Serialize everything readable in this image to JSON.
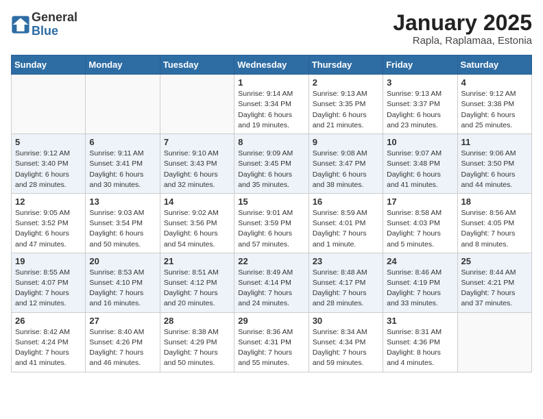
{
  "header": {
    "logo_general": "General",
    "logo_blue": "Blue",
    "month_title": "January 2025",
    "location": "Rapla, Raplamaa, Estonia"
  },
  "weekdays": [
    "Sunday",
    "Monday",
    "Tuesday",
    "Wednesday",
    "Thursday",
    "Friday",
    "Saturday"
  ],
  "weeks": [
    [
      {
        "day": "",
        "info": ""
      },
      {
        "day": "",
        "info": ""
      },
      {
        "day": "",
        "info": ""
      },
      {
        "day": "1",
        "info": "Sunrise: 9:14 AM\nSunset: 3:34 PM\nDaylight: 6 hours\nand 19 minutes."
      },
      {
        "day": "2",
        "info": "Sunrise: 9:13 AM\nSunset: 3:35 PM\nDaylight: 6 hours\nand 21 minutes."
      },
      {
        "day": "3",
        "info": "Sunrise: 9:13 AM\nSunset: 3:37 PM\nDaylight: 6 hours\nand 23 minutes."
      },
      {
        "day": "4",
        "info": "Sunrise: 9:12 AM\nSunset: 3:38 PM\nDaylight: 6 hours\nand 25 minutes."
      }
    ],
    [
      {
        "day": "5",
        "info": "Sunrise: 9:12 AM\nSunset: 3:40 PM\nDaylight: 6 hours\nand 28 minutes."
      },
      {
        "day": "6",
        "info": "Sunrise: 9:11 AM\nSunset: 3:41 PM\nDaylight: 6 hours\nand 30 minutes."
      },
      {
        "day": "7",
        "info": "Sunrise: 9:10 AM\nSunset: 3:43 PM\nDaylight: 6 hours\nand 32 minutes."
      },
      {
        "day": "8",
        "info": "Sunrise: 9:09 AM\nSunset: 3:45 PM\nDaylight: 6 hours\nand 35 minutes."
      },
      {
        "day": "9",
        "info": "Sunrise: 9:08 AM\nSunset: 3:47 PM\nDaylight: 6 hours\nand 38 minutes."
      },
      {
        "day": "10",
        "info": "Sunrise: 9:07 AM\nSunset: 3:48 PM\nDaylight: 6 hours\nand 41 minutes."
      },
      {
        "day": "11",
        "info": "Sunrise: 9:06 AM\nSunset: 3:50 PM\nDaylight: 6 hours\nand 44 minutes."
      }
    ],
    [
      {
        "day": "12",
        "info": "Sunrise: 9:05 AM\nSunset: 3:52 PM\nDaylight: 6 hours\nand 47 minutes."
      },
      {
        "day": "13",
        "info": "Sunrise: 9:03 AM\nSunset: 3:54 PM\nDaylight: 6 hours\nand 50 minutes."
      },
      {
        "day": "14",
        "info": "Sunrise: 9:02 AM\nSunset: 3:56 PM\nDaylight: 6 hours\nand 54 minutes."
      },
      {
        "day": "15",
        "info": "Sunrise: 9:01 AM\nSunset: 3:59 PM\nDaylight: 6 hours\nand 57 minutes."
      },
      {
        "day": "16",
        "info": "Sunrise: 8:59 AM\nSunset: 4:01 PM\nDaylight: 7 hours\nand 1 minute."
      },
      {
        "day": "17",
        "info": "Sunrise: 8:58 AM\nSunset: 4:03 PM\nDaylight: 7 hours\nand 5 minutes."
      },
      {
        "day": "18",
        "info": "Sunrise: 8:56 AM\nSunset: 4:05 PM\nDaylight: 7 hours\nand 8 minutes."
      }
    ],
    [
      {
        "day": "19",
        "info": "Sunrise: 8:55 AM\nSunset: 4:07 PM\nDaylight: 7 hours\nand 12 minutes."
      },
      {
        "day": "20",
        "info": "Sunrise: 8:53 AM\nSunset: 4:10 PM\nDaylight: 7 hours\nand 16 minutes."
      },
      {
        "day": "21",
        "info": "Sunrise: 8:51 AM\nSunset: 4:12 PM\nDaylight: 7 hours\nand 20 minutes."
      },
      {
        "day": "22",
        "info": "Sunrise: 8:49 AM\nSunset: 4:14 PM\nDaylight: 7 hours\nand 24 minutes."
      },
      {
        "day": "23",
        "info": "Sunrise: 8:48 AM\nSunset: 4:17 PM\nDaylight: 7 hours\nand 28 minutes."
      },
      {
        "day": "24",
        "info": "Sunrise: 8:46 AM\nSunset: 4:19 PM\nDaylight: 7 hours\nand 33 minutes."
      },
      {
        "day": "25",
        "info": "Sunrise: 8:44 AM\nSunset: 4:21 PM\nDaylight: 7 hours\nand 37 minutes."
      }
    ],
    [
      {
        "day": "26",
        "info": "Sunrise: 8:42 AM\nSunset: 4:24 PM\nDaylight: 7 hours\nand 41 minutes."
      },
      {
        "day": "27",
        "info": "Sunrise: 8:40 AM\nSunset: 4:26 PM\nDaylight: 7 hours\nand 46 minutes."
      },
      {
        "day": "28",
        "info": "Sunrise: 8:38 AM\nSunset: 4:29 PM\nDaylight: 7 hours\nand 50 minutes."
      },
      {
        "day": "29",
        "info": "Sunrise: 8:36 AM\nSunset: 4:31 PM\nDaylight: 7 hours\nand 55 minutes."
      },
      {
        "day": "30",
        "info": "Sunrise: 8:34 AM\nSunset: 4:34 PM\nDaylight: 7 hours\nand 59 minutes."
      },
      {
        "day": "31",
        "info": "Sunrise: 8:31 AM\nSunset: 4:36 PM\nDaylight: 8 hours\nand 4 minutes."
      },
      {
        "day": "",
        "info": ""
      }
    ]
  ]
}
